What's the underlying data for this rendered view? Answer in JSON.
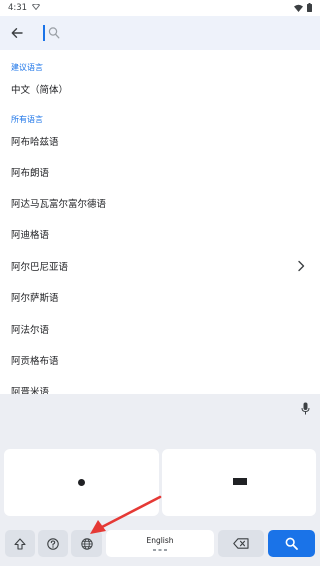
{
  "status_bar": {
    "time": "4:31"
  },
  "search": {
    "placeholder": "",
    "value": ""
  },
  "sections": {
    "suggested_header": "建议语言",
    "all_header": "所有语言"
  },
  "suggested_languages": [
    "中文（简体）"
  ],
  "all_languages": [
    "阿布哈兹语",
    "阿布朗语",
    "阿达马瓦富尔富尔德语",
    "阿迪格语",
    "阿尔巴尼亚语",
    "阿尔萨斯语",
    "阿法尔语",
    "阿贡格布语",
    "阿晋米语"
  ],
  "keyboard": {
    "space_label": "English"
  },
  "colors": {
    "accent": "#1a73e8",
    "header_bg": "#eef2fa",
    "keyboard_bg": "#eceef3",
    "annotation": "#e53935"
  }
}
